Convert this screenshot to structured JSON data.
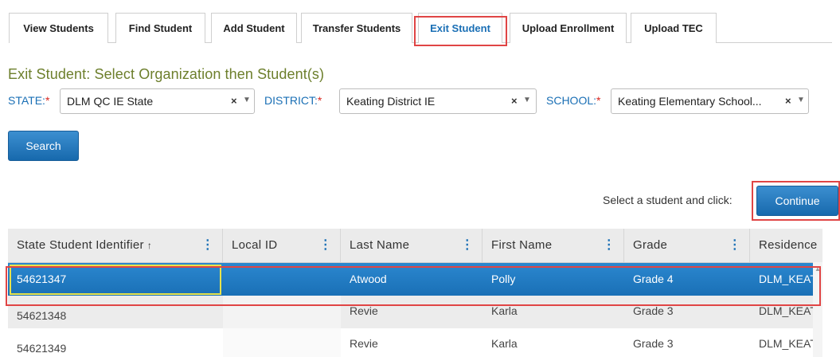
{
  "tabs": [
    {
      "label": "View Students",
      "active": false
    },
    {
      "label": "Find Student",
      "active": false
    },
    {
      "label": "Add Student",
      "active": false
    },
    {
      "label": "Transfer Students",
      "active": false
    },
    {
      "label": "Exit Student",
      "active": true
    },
    {
      "label": "Upload Enrollment",
      "active": false
    },
    {
      "label": "Upload TEC",
      "active": false
    }
  ],
  "page_title": "Exit Student: Select Organization then Student(s)",
  "filters": {
    "state": {
      "label": "STATE:",
      "required_mark": "*",
      "value": "DLM QC IE State"
    },
    "district": {
      "label": "DISTRICT:",
      "required_mark": "*",
      "value": "Keating District IE"
    },
    "school": {
      "label": "SCHOOL:",
      "required_mark": "*",
      "value": "Keating Elementary School..."
    },
    "clear_glyph": "×",
    "arrow_glyph": "▼"
  },
  "search_button": "Search",
  "continue_hint": "Select a student and click:",
  "continue_button": "Continue",
  "grid": {
    "columns": [
      {
        "label": "State Student Identifier",
        "sorted": "asc"
      },
      {
        "label": "Local ID"
      },
      {
        "label": "Last Name"
      },
      {
        "label": "First Name"
      },
      {
        "label": "Grade"
      },
      {
        "label": "Residence"
      }
    ],
    "sort_glyph": "↑",
    "menu_glyph": "⋮",
    "rows": [
      {
        "id": "54621347",
        "local_id": "",
        "last": "Atwood",
        "first": "Polly",
        "grade": "Grade 4",
        "residence": "DLM_KEAT",
        "selected": true
      },
      {
        "id": "54621348",
        "local_id": "",
        "last": "Revie",
        "first": "Karla",
        "grade": "Grade 3",
        "residence": "DLM_KEAT",
        "selected": false
      },
      {
        "id": "54621349",
        "local_id": "",
        "last": "Revie",
        "first": "Karla",
        "grade": "Grade 3",
        "residence": "DLM_KEAT",
        "selected": false
      }
    ]
  },
  "colors": {
    "accent": "#1a6fb5",
    "title_green": "#6d7f2c",
    "highlight_red": "#e04545",
    "focus_yellow": "#e8e34a"
  }
}
